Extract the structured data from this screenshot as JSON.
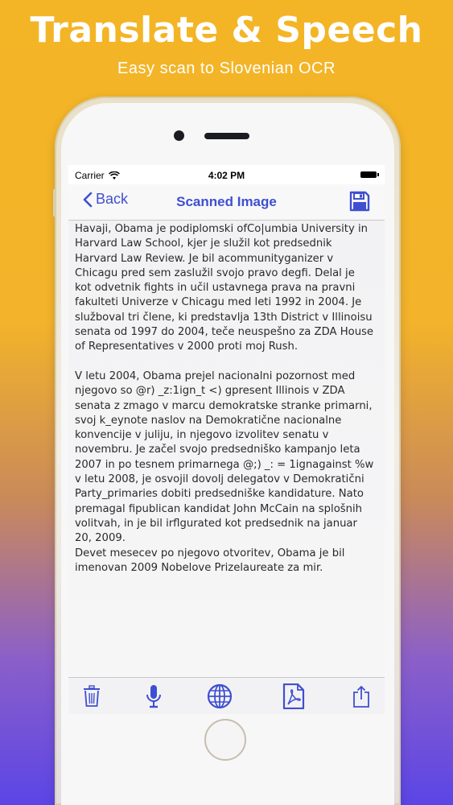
{
  "promo": {
    "title": "Translate & Speech",
    "subtitle": "Easy scan to Slovenian OCR"
  },
  "statusbar": {
    "carrier": "Carrier",
    "time": "4:02 PM"
  },
  "navbar": {
    "back_label": "Back",
    "title": "Scanned Image"
  },
  "content": {
    "ocr_text": "Havaji, Obama je podiplomski ofCo|umbia University in Harvard Law School, kjer je služil kot predsednik Harvard Law Review. Je bil acommunityganizer v Chicagu pred sem zaslužil svojo pravo degfi. Delal je kot odvetnik fights in učil ustavnega prava na pravni fakulteti Univerze v Chicagu med leti 1992 in 2004. Je služboval tri člene, ki predstavlja 13th District v Illinoisu senata od 1997 do 2004, teče neuspešno za ZDA House of Representatives v 2000 proti moj Rush.\n\nV letu 2004, Obama prejel nacionalni pozornost med njegovo so @r) _z:1ign_t <) gpresent Illinois v ZDA senata z zmago v marcu demokratske stranke primarni, svoj k_eynote naslov na Demokratične nacionalne konvencije v juliju, in njegovo izvolitev senatu v novembru. Je začel svojo predsedniško kampanjo leta 2007 in po tesnem primarnega @;) _: = 1ignagainst %w v letu 2008, je osvojil dovolj delegatov v Demokratični Party_primaries dobiti predsedniške kandidature. Nato premagal fipublican kandidat John McCain na splošnih volitvah, in je bil irflgurated kot predsednik na januar 20, 2009.\nDevet mesecev po njegovo otvoritev, Obama je bil imenovan 2009 Nobelove Prizelaureate za mir."
  },
  "toolbar": {
    "icons": [
      "trash-icon",
      "microphone-icon",
      "globe-icon",
      "pdf-icon",
      "share-icon"
    ]
  },
  "colors": {
    "accent": "#3f4fd1",
    "gradient_top": "#f3b526",
    "gradient_bottom": "#5b45e6"
  }
}
